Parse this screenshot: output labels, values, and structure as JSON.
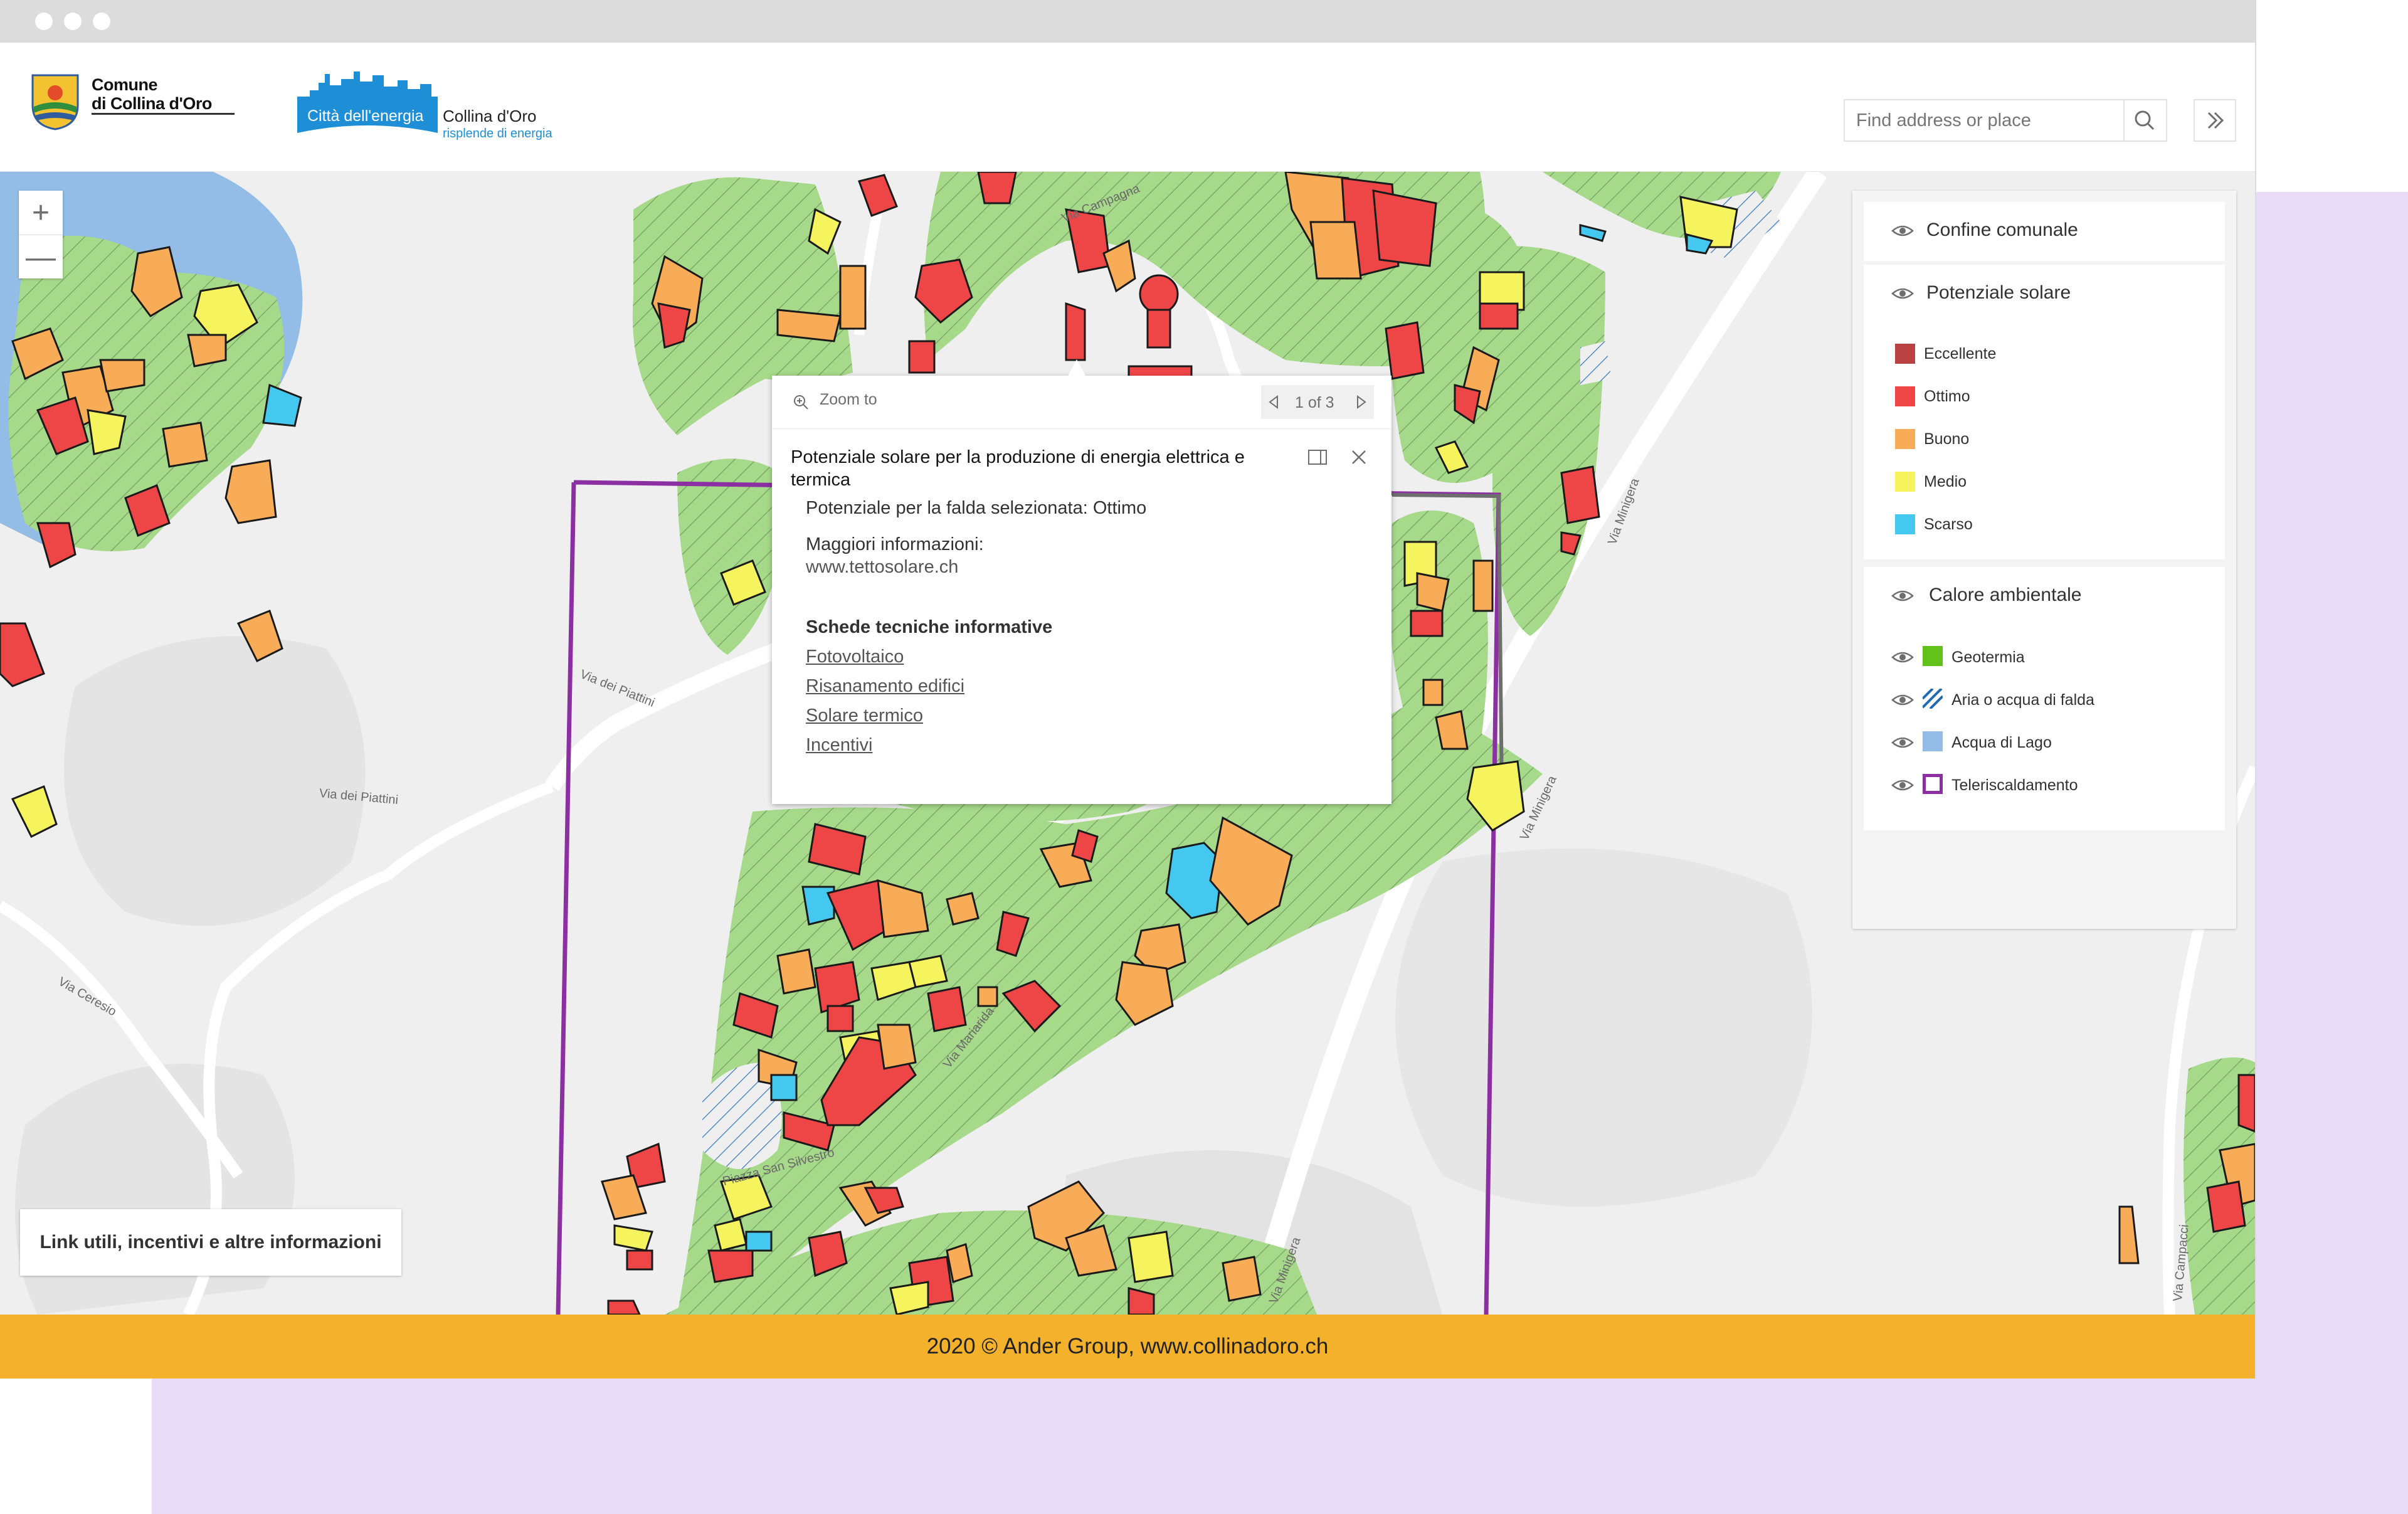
{
  "window": {
    "controls": [
      "close",
      "minimize",
      "maximize"
    ]
  },
  "header": {
    "logo1_line1": "Comune",
    "logo1_line2": "di Collina d'Oro",
    "logo2_badge": "Città dell'energia",
    "logo2_name": "Collina d'Oro",
    "logo2_tagline": "risplende di energia",
    "search_placeholder": "Find address or place",
    "search_icon": "search-icon",
    "expand_icon": "double-chevron-right-icon"
  },
  "map": {
    "zoom_in": "+",
    "zoom_out": "—",
    "streets": [
      "Via Campagna",
      "Via Minigera",
      "Via dei Piattini",
      "Via dei Piattini",
      "Via Ceresio",
      "Via Mariarida",
      "Piazza San Silvestro",
      "Via Campacci",
      "Via Minigera",
      "Via Minigera"
    ],
    "link_button": "Link utili, incentivi e altre informazioni"
  },
  "popup": {
    "zoom_to": "Zoom to",
    "pager": "1 of 3",
    "title": "Potenziale solare per la produzione di energia elettrica e termica",
    "line1": "Potenziale per la falda selezionata: Ottimo",
    "more_info_label": "Maggiori informazioni:",
    "more_info_url": "www.tettosolare.ch",
    "section_title": "Schede tecniche informative",
    "links": [
      "Fotovoltaico",
      "Risanamento edifici",
      "Solare termico",
      "Incentivi"
    ]
  },
  "layers": {
    "confine": "Confine comunale",
    "solare": {
      "title": "Potenziale solare",
      "items": [
        {
          "label": "Eccellente",
          "color": "#b94141"
        },
        {
          "label": "Ottimo",
          "color": "#ee4646"
        },
        {
          "label": "Buono",
          "color": "#f8ac57"
        },
        {
          "label": "Medio",
          "color": "#f6f45e"
        },
        {
          "label": "Scarso",
          "color": "#45c8f0"
        }
      ]
    },
    "calore": {
      "title": "Calore ambientale",
      "items": [
        {
          "label": "Geotermia",
          "color": "#62c21a"
        },
        {
          "label": "Aria o acqua di falda",
          "color": "#1e6bb5"
        },
        {
          "label": "Acqua di Lago",
          "color": "#93bde6"
        },
        {
          "label": "Teleriscaldamento",
          "color": "#8b2fa3"
        }
      ]
    }
  },
  "footer": "2020 © Ander Group, www.collinadoro.ch"
}
